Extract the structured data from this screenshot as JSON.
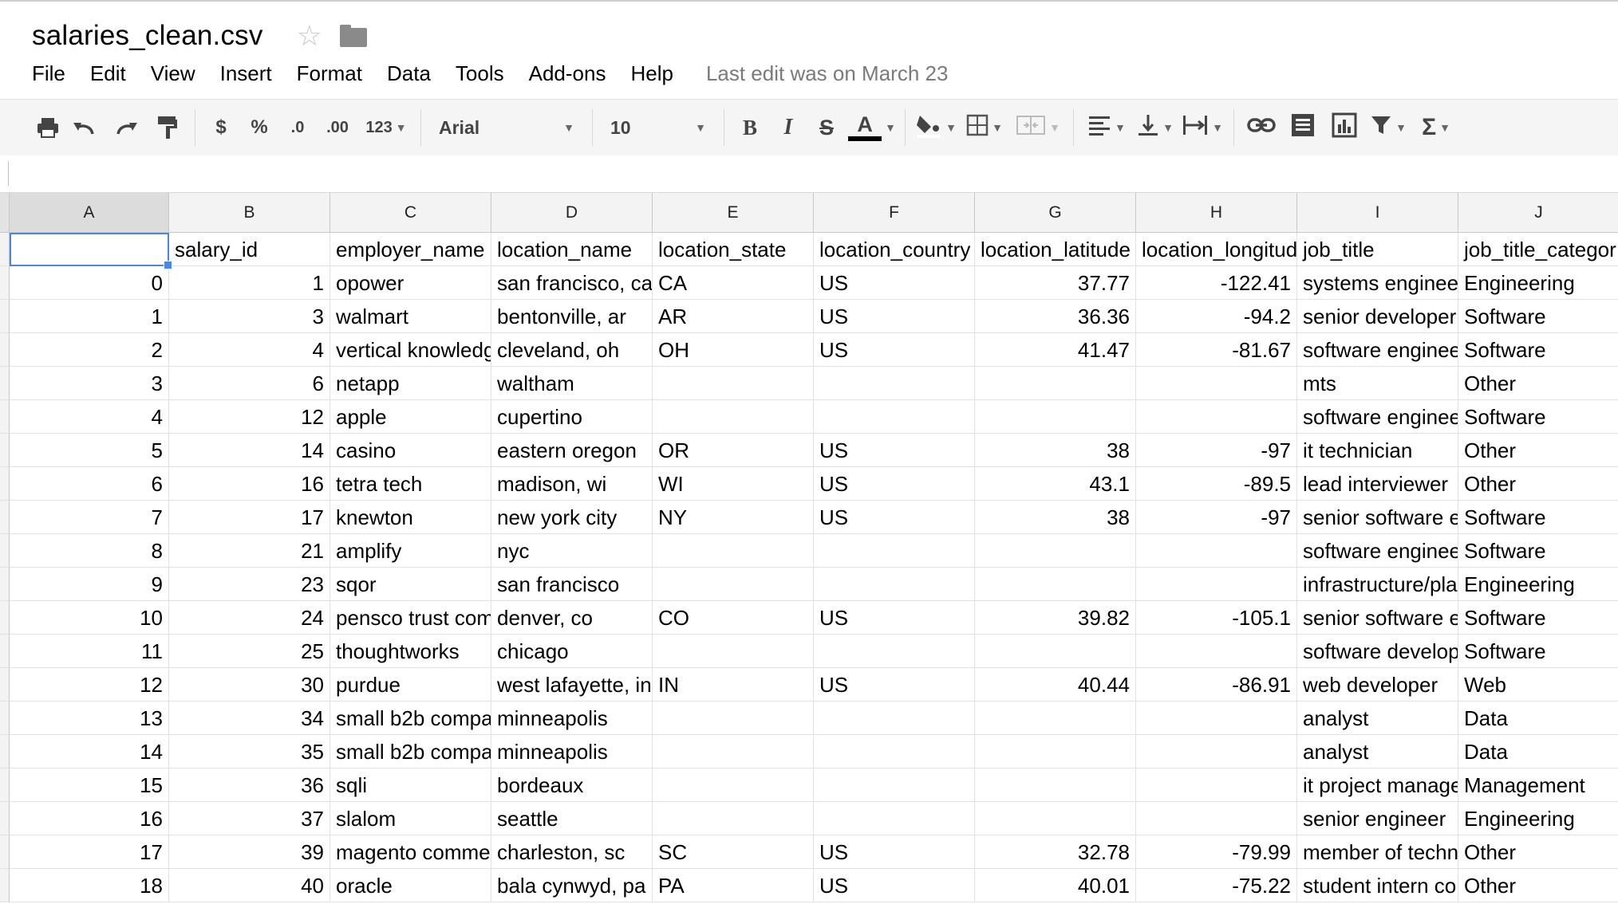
{
  "document": {
    "title": "salaries_clean.csv"
  },
  "menu": {
    "items": [
      "File",
      "Edit",
      "View",
      "Insert",
      "Format",
      "Data",
      "Tools",
      "Add-ons",
      "Help"
    ],
    "last_edit": "Last edit was on March 23"
  },
  "toolbar": {
    "currency": "$",
    "percent": "%",
    "decrease_decimal": ".0",
    "increase_decimal": ".00",
    "more_formats": "123",
    "font": "Arial",
    "font_size": "10",
    "bold": "B",
    "italic": "I",
    "strikethrough": "S",
    "text_color_label": "A",
    "text_color": "#000000",
    "accent_color": "#4a86e8"
  },
  "grid": {
    "column_letters": [
      "A",
      "B",
      "C",
      "D",
      "E",
      "F",
      "G",
      "H",
      "I",
      "J"
    ],
    "selected_cell": "A1",
    "header_row": [
      "",
      "salary_id",
      "employer_name",
      "location_name",
      "location_state",
      "location_country",
      "location_latitude",
      "location_longitud",
      "job_title",
      "job_title_categor"
    ],
    "rows": [
      [
        "0",
        "1",
        "opower",
        "san francisco, ca",
        "CA",
        "US",
        "37.77",
        "-122.41",
        "systems enginee",
        "Engineering"
      ],
      [
        "1",
        "3",
        "walmart",
        "bentonville, ar",
        "AR",
        "US",
        "36.36",
        "-94.2",
        "senior developer",
        "Software"
      ],
      [
        "2",
        "4",
        "vertical knowledg",
        "cleveland, oh",
        "OH",
        "US",
        "41.47",
        "-81.67",
        "software enginee",
        "Software"
      ],
      [
        "3",
        "6",
        "netapp",
        "waltham",
        "",
        "",
        "",
        "",
        "mts",
        "Other"
      ],
      [
        "4",
        "12",
        "apple",
        "cupertino",
        "",
        "",
        "",
        "",
        "software enginee",
        "Software"
      ],
      [
        "5",
        "14",
        "casino",
        "eastern oregon",
        "OR",
        "US",
        "38",
        "-97",
        "it technician",
        "Other"
      ],
      [
        "6",
        "16",
        "tetra tech",
        "madison, wi",
        "WI",
        "US",
        "43.1",
        "-89.5",
        "lead interviewer",
        "Other"
      ],
      [
        "7",
        "17",
        "knewton",
        "new york city",
        "NY",
        "US",
        "38",
        "-97",
        "senior software e",
        "Software"
      ],
      [
        "8",
        "21",
        "amplify",
        "nyc",
        "",
        "",
        "",
        "",
        "software enginee",
        "Software"
      ],
      [
        "9",
        "23",
        "sqor",
        "san francisco",
        "",
        "",
        "",
        "",
        "infrastructure/pla",
        "Engineering"
      ],
      [
        "10",
        "24",
        "pensco trust com",
        "denver, co",
        "CO",
        "US",
        "39.82",
        "-105.1",
        "senior software e",
        "Software"
      ],
      [
        "11",
        "25",
        "thoughtworks",
        "chicago",
        "",
        "",
        "",
        "",
        "software develop",
        "Software"
      ],
      [
        "12",
        "30",
        "purdue",
        "west lafayette, in",
        "IN",
        "US",
        "40.44",
        "-86.91",
        "web developer",
        "Web"
      ],
      [
        "13",
        "34",
        "small b2b compa",
        "minneapolis",
        "",
        "",
        "",
        "",
        "analyst",
        "Data"
      ],
      [
        "14",
        "35",
        "small b2b compa",
        "minneapolis",
        "",
        "",
        "",
        "",
        "analyst",
        "Data"
      ],
      [
        "15",
        "36",
        "sqli",
        "bordeaux",
        "",
        "",
        "",
        "",
        "it project manage",
        "Management"
      ],
      [
        "16",
        "37",
        "slalom",
        "seattle",
        "",
        "",
        "",
        "",
        "senior engineer",
        "Engineering"
      ],
      [
        "17",
        "39",
        "magento comme",
        "charleston, sc",
        "SC",
        "US",
        "32.78",
        "-79.99",
        "member of techn",
        "Other"
      ],
      [
        "18",
        "40",
        "oracle",
        "bala cynwyd, pa",
        "PA",
        "US",
        "40.01",
        "-75.22",
        "student intern co",
        "Other"
      ]
    ]
  }
}
